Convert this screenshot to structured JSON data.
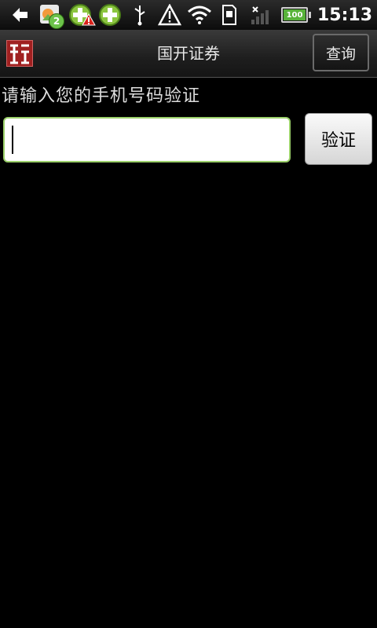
{
  "status_bar": {
    "time": "15:13",
    "notification_count": "2",
    "battery_level": "100",
    "icons": [
      "back-arrow-icon",
      "photo-notification-icon",
      "plus-app-icon",
      "warning-triangle-icon",
      "plus-app-icon",
      "usb-icon",
      "alert-icon",
      "wifi-icon",
      "sd-card-icon",
      "signal-icon",
      "battery-icon"
    ]
  },
  "titlebar": {
    "title": "国开证券",
    "query_label": "查询",
    "logo_icon": "broker-logo-icon"
  },
  "form": {
    "prompt": "请输入您的手机号码验证",
    "phone_value": "",
    "verify_label": "验证"
  },
  "colors": {
    "background": "#000000",
    "input_border": "#9bd06a",
    "logo_red": "#a02020"
  }
}
